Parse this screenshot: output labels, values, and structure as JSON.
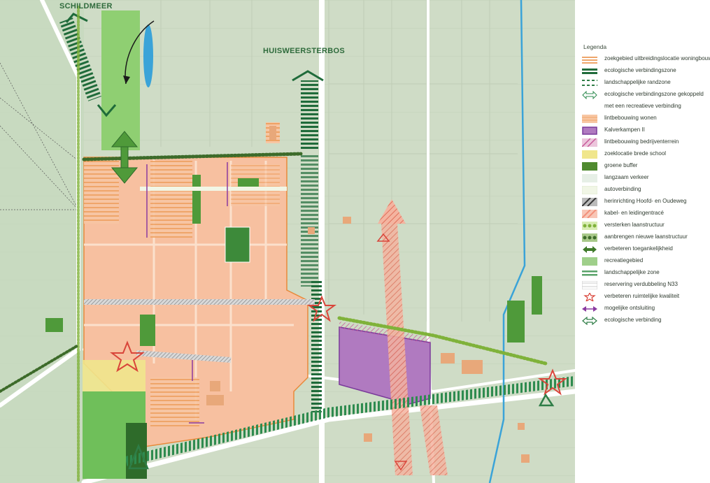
{
  "map": {
    "places": {
      "schildmeer": "SCHILDMEER",
      "huisweersterbos": "HUISWEERSTERBOS"
    }
  },
  "legend": {
    "title": "Legenda",
    "items": [
      {
        "label": "zoekgebied uitbreidingslocatie woningbouw",
        "symbol": "orange-lines",
        "color": "#e8893a"
      },
      {
        "label": "ecologische verbindingszone",
        "symbol": "dark-green-lines",
        "color": "#1f6b3a"
      },
      {
        "label": "landschappelijke randzone",
        "symbol": "dashed-green",
        "color": "#2e7d46"
      },
      {
        "label": "ecologische verbindingszone gekoppeld",
        "symbol": "hatched-arrow",
        "color": "#2e8b4f"
      },
      {
        "label": "met een recreatieve verbinding",
        "symbol": "none",
        "color": ""
      },
      {
        "label": "lintbebouwing wonen",
        "symbol": "orange-hatch",
        "color": "#f2a56b"
      },
      {
        "label": "Kalverkampen II",
        "symbol": "purple-box",
        "color": "#b07ac0"
      },
      {
        "label": "lintbebouwing bedrijventerrein",
        "symbol": "pink-hatch",
        "color": "#c85a9a"
      },
      {
        "label": "zoeklocatie brede school",
        "symbol": "yellow-box",
        "color": "#f0e68c"
      },
      {
        "label": "groene buffer",
        "symbol": "green-box",
        "color": "#4f8a2f"
      },
      {
        "label": "langzaam verkeer",
        "symbol": "light-box",
        "color": "#e6efe6"
      },
      {
        "label": "autoverbinding",
        "symbol": "pale-box",
        "color": "#f1f6e6"
      },
      {
        "label": "herinrichting Hoofd- en Oudeweg",
        "symbol": "dark-hatch",
        "color": "#3a3a3a"
      },
      {
        "label": "kabel- en leidingentracé",
        "symbol": "salmon-hatch",
        "color": "#f2907a"
      },
      {
        "label": "versterken laanstructuur",
        "symbol": "dots-light",
        "color": "#7fb23a"
      },
      {
        "label": "aanbrengen nieuwe laanstructuur",
        "symbol": "dots-dark",
        "color": "#3d6b2a"
      },
      {
        "label": "verbeteren toegankelijkheid",
        "symbol": "double-arrow-green",
        "color": "#3f7a2a"
      },
      {
        "label": "recreatiegebied",
        "symbol": "rec-box",
        "color": "#9fcf8a"
      },
      {
        "label": "landschappelijke zone",
        "symbol": "green-lines-light",
        "color": "#5aa36a"
      },
      {
        "label": "reservering verdubbeling N33",
        "symbol": "white-hatch",
        "color": "#cccccc"
      },
      {
        "label": "verbeteren ruimtelijke kwaliteit",
        "symbol": "red-star",
        "color": "#d9453a"
      },
      {
        "label": "mogelijke ontsluiting",
        "symbol": "purple-arrow",
        "color": "#8a3aa0"
      },
      {
        "label": "ecologische verbinding",
        "symbol": "eco-arrow",
        "color": "#2e7d46"
      }
    ]
  }
}
